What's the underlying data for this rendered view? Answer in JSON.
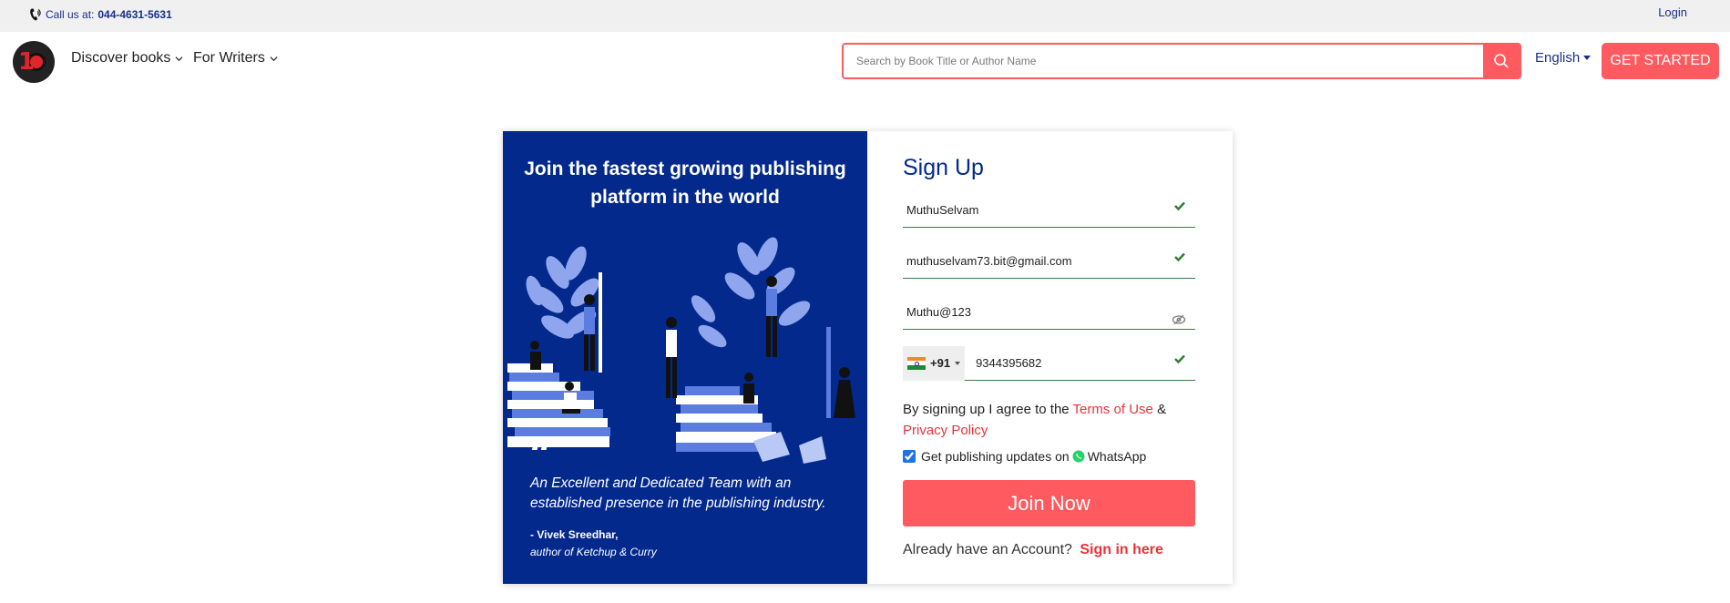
{
  "topbar": {
    "call_prefix": "Call us at:",
    "phone": "044-4631-5631",
    "login": "Login"
  },
  "nav": {
    "discover": "Discover books",
    "writers": "For Writers",
    "search_placeholder": "Search by Book Title or Author Name",
    "language": "English",
    "get_started": "GET STARTED"
  },
  "promo": {
    "heading": "Join the fastest growing publishing platform in the world",
    "quote_mark": "“",
    "quote": "An Excellent and Dedicated Team with an established presence in the publishing industry.",
    "author": "- Vivek Sreedhar,",
    "book": "author of Ketchup & Curry"
  },
  "form": {
    "title": "Sign Up",
    "name_value": "MuthuSelvam",
    "email_value": "muthuselvam73.bit@gmail.com",
    "password_value": "Muthu@123",
    "dial_code": "+91",
    "phone_value": "9344395682",
    "agree_prefix": "By signing up I agree to the",
    "terms": "Terms of Use",
    "amp": "&",
    "privacy": "Privacy Policy",
    "updates_text": "Get publishing updates on",
    "whatsapp": "WhatsApp",
    "join": "Join Now",
    "already": "Already have an Account?",
    "sign_in": "Sign in here"
  },
  "colors": {
    "brand_blue": "#03298c",
    "accent_red": "#ff5a5f",
    "valid_green": "#3a7d44"
  }
}
